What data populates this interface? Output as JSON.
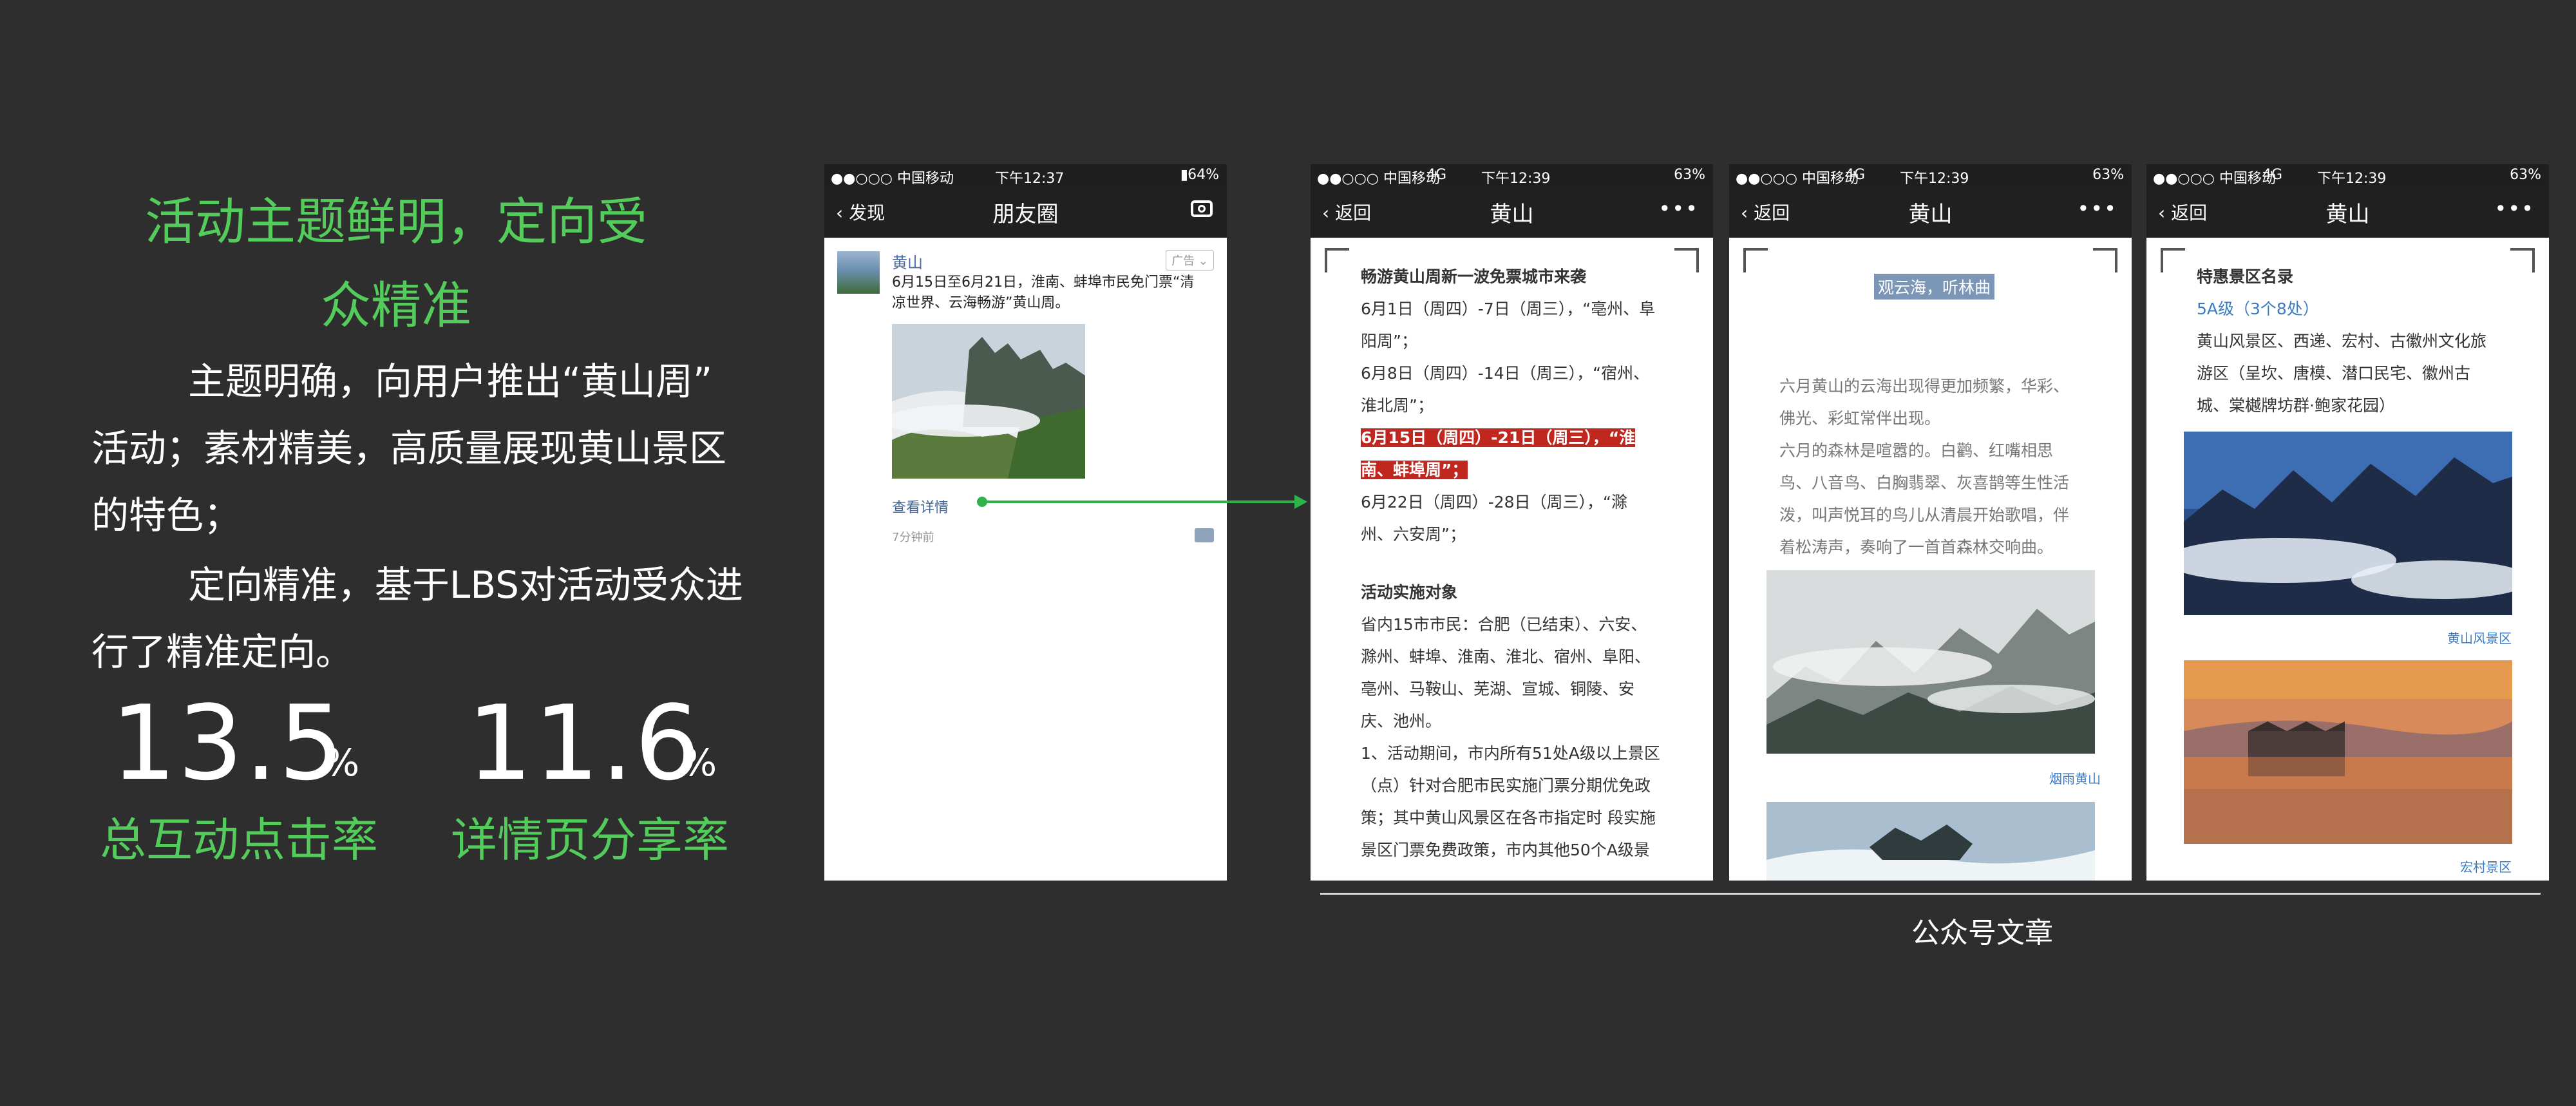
{
  "left_panel": {
    "headline_line1": "活动主题鲜明，定向受",
    "headline_line2": "众精准",
    "para1_line1": "主题明确，向用户推出“黄山周”",
    "para1_line2": "活动；素材精美，高质量展现黄山景区",
    "para1_line3": "的特色；",
    "para2_line1": "定向精准，基于LBS对活动受众进",
    "para2_line2": "行了精准定向。",
    "stats": [
      {
        "value": "13.5",
        "unit": "%",
        "label": "总互动点击率"
      },
      {
        "value": "11.6",
        "unit": "%",
        "label": "详情页分享率"
      }
    ]
  },
  "phone_moments": {
    "status_carrier": "●●○○○ 中国移动",
    "status_time": "下午12:37",
    "status_battery": "64%",
    "back_label": "发现",
    "title": "朋友圈",
    "post_author": "黄山",
    "ad_tag": "广告",
    "post_text": "6月15日至6月21日，淮南、蚌埠市民免门票“清凉世界、云海畅游”黄山周。",
    "detail_link": "查看详情",
    "time_ago": "7分钟前"
  },
  "phone_article1": {
    "status_carrier": "●●○○○ 中国移动",
    "status_network": "4G",
    "status_time": "下午12:39",
    "status_battery": "63%",
    "back_label": "返回",
    "title": "黄山",
    "heading": "畅游黄山周新一波免票城市来袭",
    "line1": "6月1日（周四）-7日（周三），“亳州、阜",
    "line2": "阳周”；",
    "line3": "6月8日（周四）-14日（周三），“宿州、",
    "line4": "淮北周”；",
    "line5": "6月15日（周四）-21日（周三），“淮",
    "line6": "南、蚌埠周”；",
    "line7": "6月22日（周四）-28日（周三），“滁",
    "line8": "州、六安周”；",
    "subheading": "活动实施对象",
    "line9": "省内15市市民：合肥（已结束）、六安、",
    "line10": "滁州、蚌埠、淮南、淮北、宿州、阜阳、",
    "line11": "亳州、马鞍山、芜湖、宣城、铜陵、安",
    "line12": "庆、池州。",
    "line13": "1、活动期间，市内所有51处A级以上景区",
    "line14": "（点）针对合肥市民实施门票分期优免政",
    "line15": "策；其中黄山风景区在各市指定时 段实施",
    "line16": "景区门票免费政策，市内其他50个A级景"
  },
  "phone_article2": {
    "status_carrier": "●●○○○ 中国移动",
    "status_network": "4G",
    "status_time": "下午12:39",
    "status_battery": "63%",
    "back_label": "返回",
    "title": "黄山",
    "section_title": "观云海，听林曲",
    "line1": "六月黄山的云海出现得更加频繁，华彩、",
    "line2": "佛光、彩虹常伴出现。",
    "line3": "六月的森林是喧嚣的。白鹳、红嘴相思",
    "line4": "鸟、八音鸟、白胸翡翠、灰喜鹊等生性活",
    "line5": "泼，叫声悦耳的鸟儿从清晨开始歌唱，伴",
    "line6": "着松涛声，奏响了一首首森林交响曲。",
    "caption1": "烟雨黄山"
  },
  "phone_article3": {
    "status_carrier": "●●○○○ 中国移动",
    "status_network": "4G",
    "status_time": "下午12:39",
    "status_battery": "63%",
    "back_label": "返回",
    "title": "黄山",
    "heading": "特惠景区名录",
    "level": "5A级（3个8处）",
    "line1": "黄山风景区、西递、宏村、古徽州文化旅",
    "line2": "游区（呈坎、唐模、潜口民宅、徽州古",
    "line3": "城、棠樾牌坊群·鲍家花园）",
    "caption1": "黄山风景区",
    "caption2": "宏村景区"
  },
  "article_group_caption": "公众号文章",
  "colors": {
    "background": "#2e2e2e",
    "accent_green": "#54cc5c",
    "arrow_green": "#2fb34c",
    "highlight_red": "#c0281f",
    "link_blue": "#3b7bc4"
  }
}
